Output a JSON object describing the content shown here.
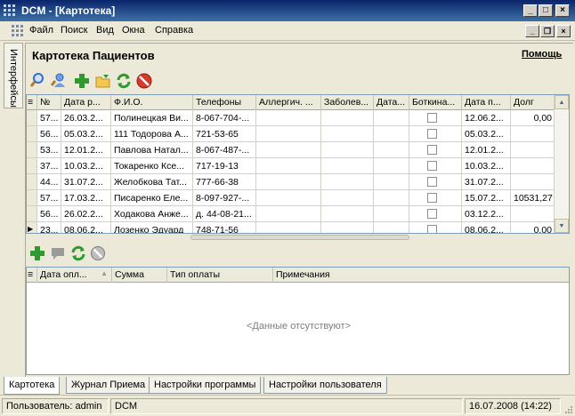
{
  "window": {
    "title": "DCM - [Картотека]",
    "min_glyph": "_",
    "max_glyph": "□",
    "close_glyph": "×",
    "restore_glyph": "❐"
  },
  "menu": {
    "items": [
      "Файл",
      "Поиск",
      "Вид",
      "Окна",
      "Справка"
    ]
  },
  "sidebar": {
    "tab_label": "Интерфейсы"
  },
  "panel": {
    "title": "Картотека Пациентов",
    "help_link": "Помощь"
  },
  "toolbar_icons": [
    "search-icon",
    "user-search-icon",
    "add-icon",
    "open-folder-icon",
    "refresh-icon",
    "stop-icon"
  ],
  "patients": {
    "row_selector_header": "≡",
    "columns": [
      "№",
      "Дата р...",
      "Ф.И.О.",
      "Телефоны",
      "Аллергич. ...",
      "Заболев...",
      "Дата...",
      "Боткина...",
      "Дата п...",
      "Долг"
    ],
    "rows": [
      {
        "marker": "",
        "id": "57...",
        "birth": "26.03.2...",
        "name": "Полинецкая Ви...",
        "phone": "8-067-704-...",
        "botkin": false,
        "date": "12.06.2...",
        "debt": "0,00"
      },
      {
        "marker": "",
        "id": "56...",
        "birth": "05.03.2...",
        "name": "111 Тодорова А...",
        "phone": "721-53-65",
        "botkin": false,
        "date": "05.03.2...",
        "debt": ""
      },
      {
        "marker": "",
        "id": "53...",
        "birth": "12.01.2...",
        "name": "Павлова Натал...",
        "phone": "8-067-487-...",
        "botkin": false,
        "date": "12.01.2...",
        "debt": ""
      },
      {
        "marker": "",
        "id": "37...",
        "birth": "10.03.2...",
        "name": "Токаренко Ксе...",
        "phone": "717-19-13",
        "botkin": false,
        "date": "10.03.2...",
        "debt": ""
      },
      {
        "marker": "",
        "id": "44...",
        "birth": "31.07.2...",
        "name": "Желобкова Тат...",
        "phone": "777-66-38",
        "botkin": false,
        "date": "31.07.2...",
        "debt": ""
      },
      {
        "marker": "",
        "id": "57...",
        "birth": "17.03.2...",
        "name": "Писаренко Еле...",
        "phone": "8-097-927-...",
        "botkin": false,
        "date": "15.07.2...",
        "debt": "10531,27"
      },
      {
        "marker": "",
        "id": "56...",
        "birth": "26.02.2...",
        "name": "Ходакова Анже...",
        "phone": "д. 44-08-21...",
        "botkin": false,
        "date": "03.12.2...",
        "debt": ""
      },
      {
        "marker": "▶",
        "id": "23...",
        "birth": "08.06.2...",
        "name": "Лозенко Эдуард",
        "phone": "748-71-56",
        "botkin": false,
        "date": "08.06.2...",
        "debt": "0,00"
      }
    ]
  },
  "payments_toolbar_icons": [
    "add-icon",
    "comment-icon",
    "refresh-icon",
    "stop-icon"
  ],
  "payments": {
    "row_selector_header": "≡",
    "columns": [
      "Дата опл...",
      "Сумма",
      "Тип оплаты",
      "Примечания"
    ],
    "sort_indicator": "▲",
    "empty_text": "<Данные отсутствуют>"
  },
  "bottom_tabs": [
    "Картотека",
    "Журнал Приема",
    "Настройки программы",
    "Настройки пользователя"
  ],
  "status": {
    "user": "Пользователь: admin",
    "app": "DCM",
    "datetime": "16.07.2008 (14:22)"
  },
  "colors": {
    "titlebar": "#0a246a",
    "accent_green": "#2f9a2f",
    "stop_red": "#d83a2a"
  }
}
